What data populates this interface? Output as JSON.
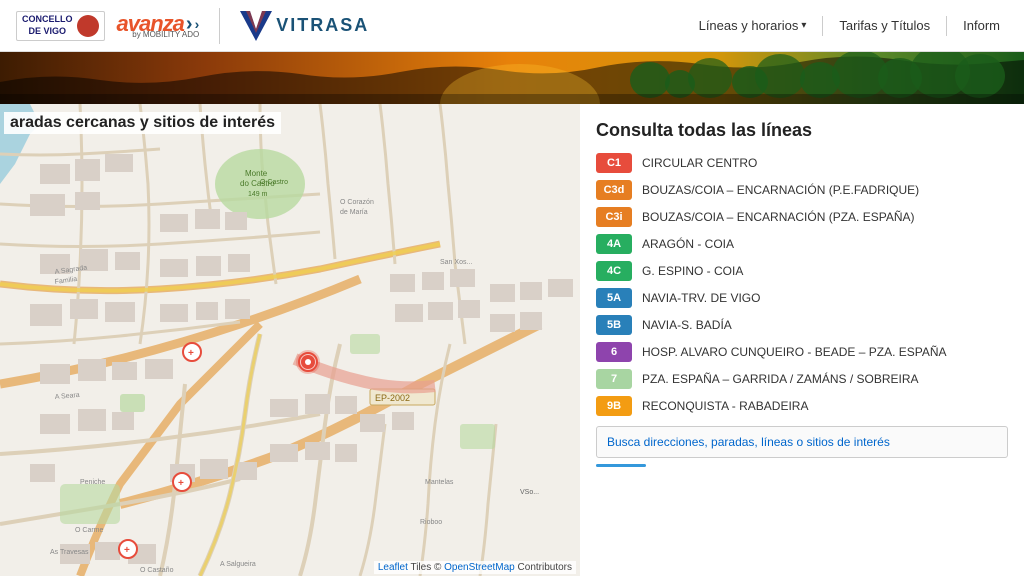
{
  "header": {
    "concello_line1": "CONCELLO",
    "concello_line2": "DE VIGO",
    "avanza_label": "avanza",
    "avanza_sub": "by MOBILITY ADO",
    "vitrasa_label": "VITRASA",
    "nav": {
      "lineas": "Líneas y horarios",
      "tarifas": "Tarifas y Títulos",
      "inform": "Inform"
    }
  },
  "map": {
    "title": "aradas cercanas y sitios de interés",
    "attribution_leaflet": "Leaflet",
    "attribution_tiles": "Tiles ©",
    "attribution_osm": "OpenStreetMap",
    "attribution_contrib": "Contributors"
  },
  "panel": {
    "title": "Consulta todas las líneas",
    "search_placeholder": "Busca direcciones, paradas, líneas o sitios de interés",
    "lines": [
      {
        "id": "C1",
        "color": "#e74c3c",
        "name": "CIRCULAR CENTRO"
      },
      {
        "id": "C3d",
        "color": "#e67e22",
        "name": "BOUZAS/COIA – ENCARNACIÓN (P.E.FADRIQUE)"
      },
      {
        "id": "C3i",
        "color": "#e67e22",
        "name": "BOUZAS/COIA – ENCARNACIÓN (PZA. ESPAÑA)"
      },
      {
        "id": "4A",
        "color": "#27ae60",
        "name": "ARAGÓN - COIA"
      },
      {
        "id": "4C",
        "color": "#27ae60",
        "name": "G. ESPINO - COIA"
      },
      {
        "id": "5A",
        "color": "#2980b9",
        "name": "NAVIA-TRV. DE VIGO"
      },
      {
        "id": "5B",
        "color": "#2980b9",
        "name": "NAVIA-S. BADÍA"
      },
      {
        "id": "6",
        "color": "#8e44ad",
        "name": "HOSP. ALVARO CUNQUEIRO - BEADE – PZA. ESPAÑA"
      },
      {
        "id": "7",
        "color": "#a8d5a2",
        "name": "PZA. ESPAÑA – GARRIDA / ZAMÁNS / SOBREIRA"
      },
      {
        "id": "9B",
        "color": "#f39c12",
        "name": "RECONQUISTA - RABADEIRA"
      }
    ]
  }
}
